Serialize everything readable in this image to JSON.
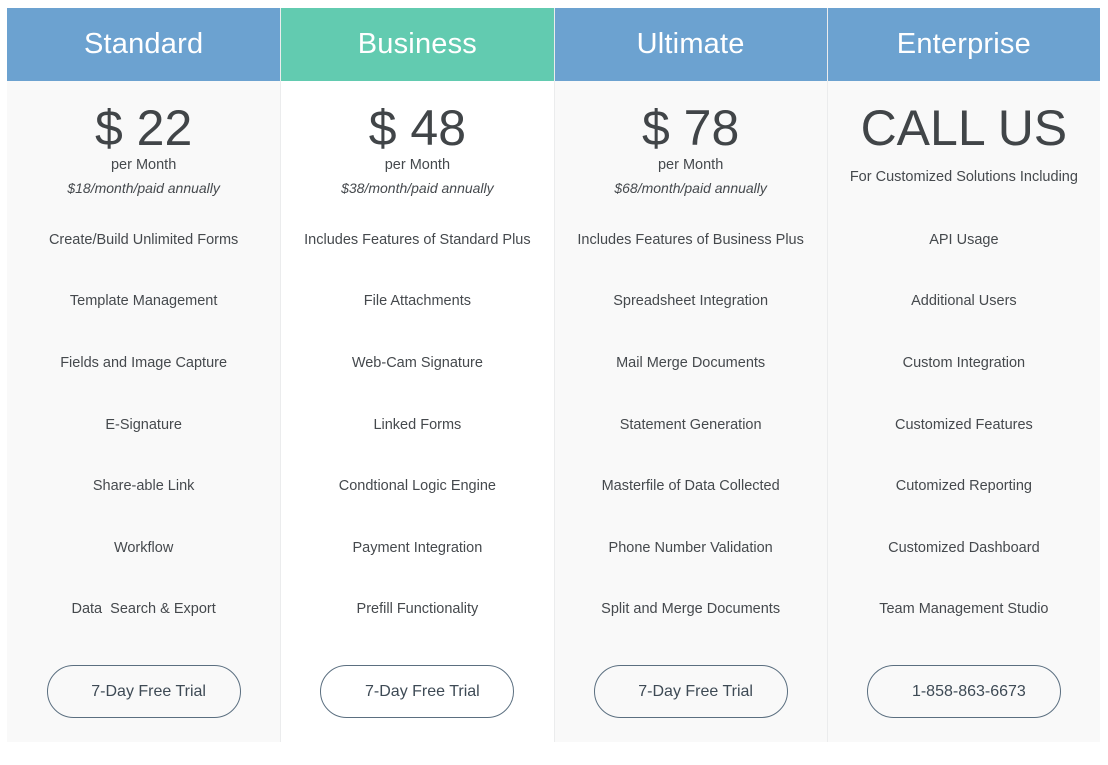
{
  "colors": {
    "header_blue": "#6ca2d0",
    "header_green": "#62cbb0",
    "button_border": "#5b6f80"
  },
  "plans": [
    {
      "name": "Standard",
      "price": "$ 22",
      "period": "per Month",
      "annual": "$18/month/paid annually",
      "features": [
        "Create/Build Unlimited Forms",
        "Template Management",
        "Fields and Image Capture",
        "E-Signature",
        "Share-able Link",
        "Workflow",
        "Data  Search & Export"
      ],
      "cta": "7-Day Free Trial"
    },
    {
      "name": "Business",
      "price": "$ 48",
      "period": "per Month",
      "annual": "$38/month/paid annually",
      "features": [
        "Includes Features of Standard Plus",
        "File Attachments",
        "Web-Cam Signature",
        "Linked Forms",
        "Condtional Logic Engine",
        "Payment Integration",
        "Prefill Functionality"
      ],
      "cta": "7-Day Free Trial"
    },
    {
      "name": "Ultimate",
      "price": "$ 78",
      "period": "per Month",
      "annual": "$68/month/paid annually",
      "features": [
        "Includes Features of Business Plus",
        "Spreadsheet Integration",
        "Mail Merge Documents",
        "Statement Generation",
        "Masterfile of Data Collected",
        "Phone Number Validation",
        "Split and Merge Documents"
      ],
      "cta": "7-Day Free Trial"
    },
    {
      "name": "Enterprise",
      "price": "CALL US",
      "subtitle": "For Customized Solutions Including",
      "features": [
        "API Usage",
        "Additional Users",
        "Custom Integration",
        "Customized Features",
        "Cutomized Reporting",
        "Customized Dashboard",
        "Team Management Studio"
      ],
      "cta": "1-858-863-6673"
    }
  ]
}
